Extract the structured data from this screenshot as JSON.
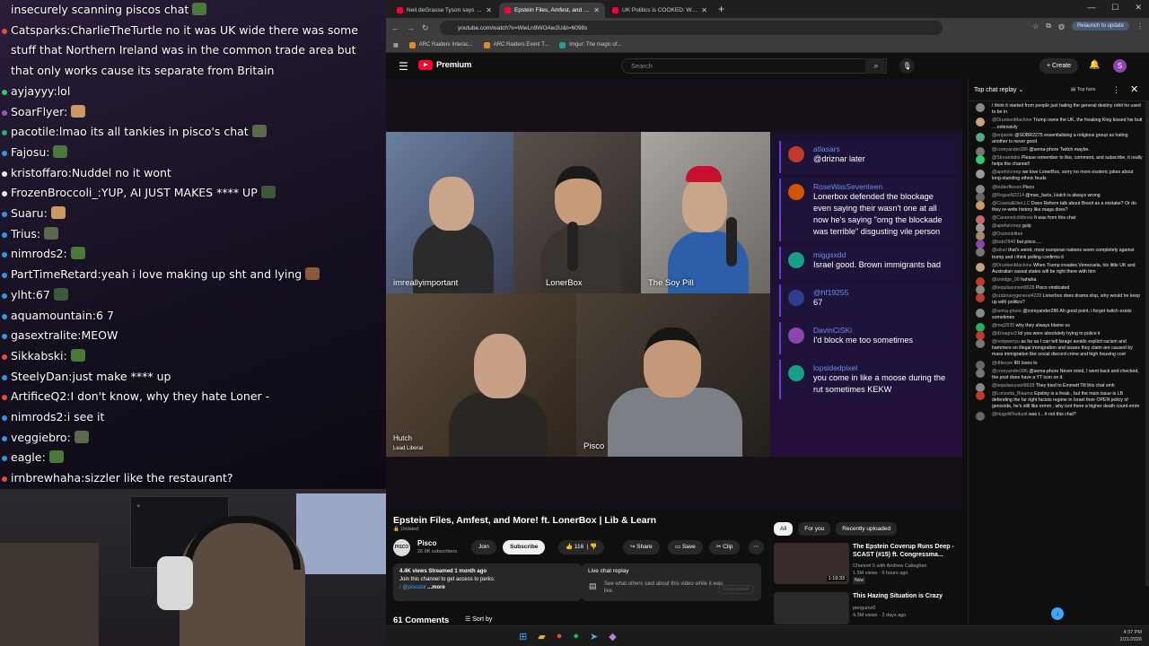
{
  "stream_chat": {
    "lines": [
      {
        "user": "",
        "text": "insecurely scanning piscos chat",
        "dot": "",
        "wrap": false
      },
      {
        "user": "Catsparks",
        "text": "CharlieTheTurtle no it was UK wide  there was some stuff that Northern Ireland was in the common trade area but that only works cause its separate from Britain",
        "dot": "#e74c3c",
        "wrap": true
      },
      {
        "user": "ayjayyy",
        "text": "lol",
        "dot": "#2ecc71",
        "wrap": false
      },
      {
        "user": "SoarFlyer",
        "text": "",
        "dot": "#9b59b6",
        "wrap": false
      },
      {
        "user": "pacotile",
        "text": "lmao its all tankies in pisco's chat",
        "dot": "#27ae60",
        "wrap": false
      },
      {
        "user": "Fajosu",
        "text": "",
        "dot": "#3498db",
        "wrap": false
      },
      {
        "user": "kristoffaro",
        "text": "Nuddel no it wont",
        "dot": "#ecf0f1",
        "wrap": false
      },
      {
        "user": "FrozenBroccoli_",
        "text": "YUP, AI JUST MAKES **** UP",
        "dot": "#ecf0f1",
        "wrap": false
      },
      {
        "user": "Suaru",
        "text": "",
        "dot": "#3498db",
        "wrap": false
      },
      {
        "user": "Trius",
        "text": "",
        "dot": "#3498db",
        "wrap": false
      },
      {
        "user": "nimrods2",
        "text": "",
        "dot": "#3498db",
        "wrap": false
      },
      {
        "user": "PartTimeRetard",
        "text": "yeah i love making up sht and lying",
        "dot": "#3498db",
        "wrap": false
      },
      {
        "user": "ylht",
        "text": "67",
        "dot": "#3498db",
        "wrap": false
      },
      {
        "user": "aquamountain",
        "text": "6 7",
        "dot": "#3498db",
        "wrap": false
      },
      {
        "user": "gasextralite",
        "text": "MEOW",
        "dot": "#3498db",
        "wrap": false
      },
      {
        "user": "Sikkabski",
        "text": "",
        "dot": "#e74c3c",
        "wrap": false
      },
      {
        "user": "SteelyDan",
        "text": "just make **** up",
        "dot": "#3498db",
        "wrap": false
      },
      {
        "user": "ArtificeQ2",
        "text": "I don't know, why they hate Loner -",
        "dot": "#e74c3c",
        "wrap": false
      },
      {
        "user": "nimrods2",
        "text": "i see it",
        "dot": "#3498db",
        "wrap": false
      },
      {
        "user": "veggiebro",
        "text": "",
        "dot": "#3498db",
        "wrap": false
      },
      {
        "user": "eagle",
        "text": "",
        "dot": "#3498db",
        "wrap": false
      },
      {
        "user": "irnbrewhaha",
        "text": "sizzler like the restaurant?",
        "dot": "#e74c3c",
        "wrap": false
      }
    ]
  },
  "browser": {
    "tabs": [
      {
        "label": "Neil deGrasse Tyson says that o",
        "active": false
      },
      {
        "label": "Epstein Files, Amfest, and More!",
        "active": true
      },
      {
        "label": "UK Politics is COOKED: Why Re",
        "active": false
      }
    ],
    "url": "youtube.com/watch?v=WwLn9WOAw2U&t=6098s",
    "relaunch": "Relaunch to update",
    "bookmarks": [
      "ARC Raiders Interac...",
      "ARC Raiders Event T...",
      "Imgur: The magic of..."
    ]
  },
  "youtube": {
    "logo": "Premium",
    "search_placeholder": "Search",
    "create": "Create",
    "avatar": "S",
    "cams": {
      "c1": "imreallyimportant",
      "c2": "LonerBox",
      "c3": "The Soy Pill",
      "c4": "Hutch",
      "c4sub": "Lead Liberal",
      "c5": "Pisco"
    },
    "overlay_chat": [
      {
        "name": "atlasars",
        "text": "@driznar later",
        "color": "#c0392b"
      },
      {
        "name": "RoseWasSeventeen",
        "text": "Lonerbox defended the blockage even saying their wasn't one at all now he's saying \"omg the blockade was terrible\" disgusting vile person",
        "color": "#d35400"
      },
      {
        "name": "miggsxdd",
        "text": "Israel good. Brown immigrants bad",
        "color": "#16a085"
      },
      {
        "name": "@hf19255",
        "text": "67",
        "color": "#2c3e8c"
      },
      {
        "name": "DavinCiSKi",
        "text": "I'd block me too sometimes",
        "color": "#8e44ad"
      },
      {
        "name": "lopsidedpixel",
        "text": "you come in like a moose during the rut sometimes KEKW",
        "color": "#16a085"
      }
    ],
    "title": "Epstein Files, Amfest, and More! ft. LonerBox | Lib & Learn",
    "unlisted": "Unlisted",
    "channel": "Pisco",
    "channel_av": "PISCO",
    "subs": "26.9K subscribers",
    "join": "Join",
    "subscribe": "Subscribe",
    "likes": "116",
    "share": "Share",
    "save": "Save",
    "clip": "Clip",
    "desc_line1": "4.4K views  Streamed 1 month ago",
    "desc_line2": "Join this channel to get access to perks:",
    "desc_line3": "/ @piscolol",
    "desc_more": "...more",
    "lcr_title": "Live chat replay",
    "lcr_sub": "See what others said about this video while it was live.",
    "lcr_btn": "Open panel",
    "comments": "61 Comments",
    "sortby": "Sort by",
    "chips": [
      "All",
      "For you",
      "Recently uploaded"
    ],
    "related": [
      {
        "title": "The Epstein Coverup Runs Deep - SCAST (#15) ft. Congressma...",
        "m1": "Channel 5 with Andrew Callaghan",
        "m2": "1.5M views · 6 hours ago",
        "badge": "New",
        "dur": "1:19:33"
      },
      {
        "title": "This Hazing Situation is Crazy",
        "m1": "penguinz0",
        "m2": "4.3M views · 2 days ago",
        "badge": "",
        "dur": ""
      }
    ]
  },
  "live_chat": {
    "title": "Top chat replay",
    "top_fans": "Top fans",
    "messages": [
      {
        "n": "",
        "t": "I think it started from people just hating the general destiny orbit he used to be in",
        "c": "#888"
      },
      {
        "n": "@DrunkenMachine",
        "t": "Trump owns the UK, the freaking King kissed his butt ... extensivly",
        "c": "#c9a27e"
      },
      {
        "n": "@enjaede",
        "t": "@SOBR2275 essentialising a religious group as hating another is never good",
        "c": "#5a8"
      },
      {
        "n": "@coreyander286",
        "t": "@sema-phore Twitch maybe.",
        "c": "#777"
      },
      {
        "n": "@Streamlabs",
        "t": "Please remember to like, comment, and subscribe, it really helps the channel!",
        "c": "#2ecc71"
      },
      {
        "n": "@apefulcreep",
        "t": "we love LonerBox. sorry no more esoteric jokes about long-standing ethnic feuds",
        "c": "#999"
      },
      {
        "n": "@butterfliesxx",
        "t": "Pisco",
        "c": "#888"
      },
      {
        "n": "@RogueN2214",
        "t": "@mac_facts, Hutch is always wrong",
        "c": "#666"
      },
      {
        "n": "@CoastalEliteLLC",
        "t": "Does Reform talk about Brexit as a mistake? Or do they re-write history like maga does?",
        "c": "#c96"
      },
      {
        "n": "@Caramelcoldbrew",
        "t": "It was from this chat",
        "c": "#c66"
      },
      {
        "n": "@apefulcreep",
        "t": "gulp",
        "c": "#999"
      },
      {
        "n": "@Oozmokittee",
        "t": "",
        "c": "#a86"
      },
      {
        "n": "@kebi7846",
        "t": "but pisco.....",
        "c": "#8e44ad"
      },
      {
        "n": "@siluxi",
        "t": "that's weird, most european nations seem completely against trump and i think polling confirms it",
        "c": "#777"
      },
      {
        "n": "@DrunkenMachine",
        "t": "When Trump invades Venezuela, his little UK and Australian vassal states will be right there with him",
        "c": "#c9a27e"
      },
      {
        "n": "@smidge_00",
        "t": "hahaha",
        "c": "#c0392b"
      },
      {
        "n": "@tequilasunset8628",
        "t": "Pisco vindicated",
        "c": "#888"
      },
      {
        "n": "@crabnavygeneral4229",
        "t": "Lonerbox does drama slop, why would he keep up with politics?",
        "c": "#c0392b"
      },
      {
        "n": "@sema-phore",
        "t": "@coreyander286 Ah good point, i forget twitch exists sometimes",
        "c": "#888"
      },
      {
        "n": "@mej2535",
        "t": "why they always blame us",
        "c": "#27ae60"
      },
      {
        "n": "@dzsagno3",
        "t": "lol you were absolutely trying to police it",
        "c": "#c0392b"
      },
      {
        "n": "@redqwertyu",
        "t": "as far as I can tell farage avoids explicit racism and hammers on illegal immigration and issues they claim are caused by mass immigration like social discord crime and high housing cost",
        "c": "#777"
      },
      {
        "n": "@dtkeyse",
        "t": "IRI loves to",
        "c": "#666"
      },
      {
        "n": "@coreyander286",
        "t": "@sema-phore Never mind, I went back and checked, the post does have a YT icon on it.",
        "c": "#777"
      },
      {
        "n": "@tequilasunset8628",
        "t": "They tried to Emmett Till this chat smh",
        "c": "#888"
      },
      {
        "n": "@Lonzetta_Blaama",
        "t": "Epstiny is a freak , but the main issue is LB defending the far right facists regime in Israel their OPEN policy of genocide, he's still like ermm , why isnt there a higher death count emm",
        "c": "#c0392b"
      },
      {
        "n": "@HugoWhodunit",
        "t": "was t... it not this chat?",
        "c": "#666"
      }
    ]
  },
  "taskbar": {
    "time": "4:37 PM",
    "date": "2/21/2026"
  }
}
